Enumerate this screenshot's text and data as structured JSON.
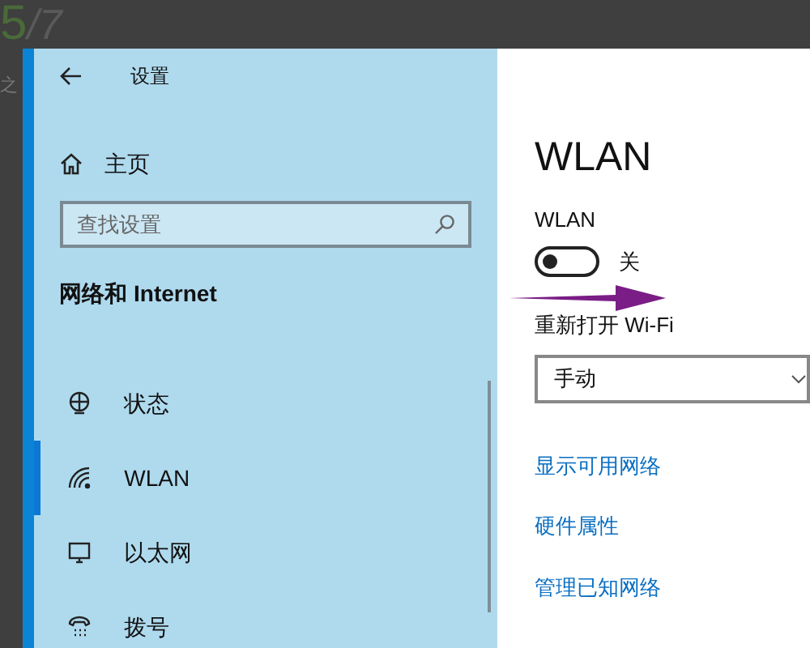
{
  "background": {
    "page_number": "5",
    "page_total": "/7",
    "text_fragment": "之"
  },
  "window": {
    "title": "设置",
    "home": "主页",
    "search": {
      "placeholder": "查找设置"
    },
    "section": "网络和 Internet",
    "nav": [
      {
        "kind": "status",
        "label": "状态",
        "selected": false
      },
      {
        "kind": "wifi",
        "label": "WLAN",
        "selected": true
      },
      {
        "kind": "ethernet",
        "label": "以太网",
        "selected": false
      },
      {
        "kind": "dialup",
        "label": "拨号",
        "selected": false
      }
    ]
  },
  "content": {
    "title": "WLAN",
    "toggle_label": "WLAN",
    "toggle": {
      "on": false,
      "state_text": "关"
    },
    "reopen_label": "重新打开 Wi-Fi",
    "reopen_value": "手动",
    "links": [
      "显示可用网络",
      "硬件属性",
      "管理已知网络"
    ]
  }
}
